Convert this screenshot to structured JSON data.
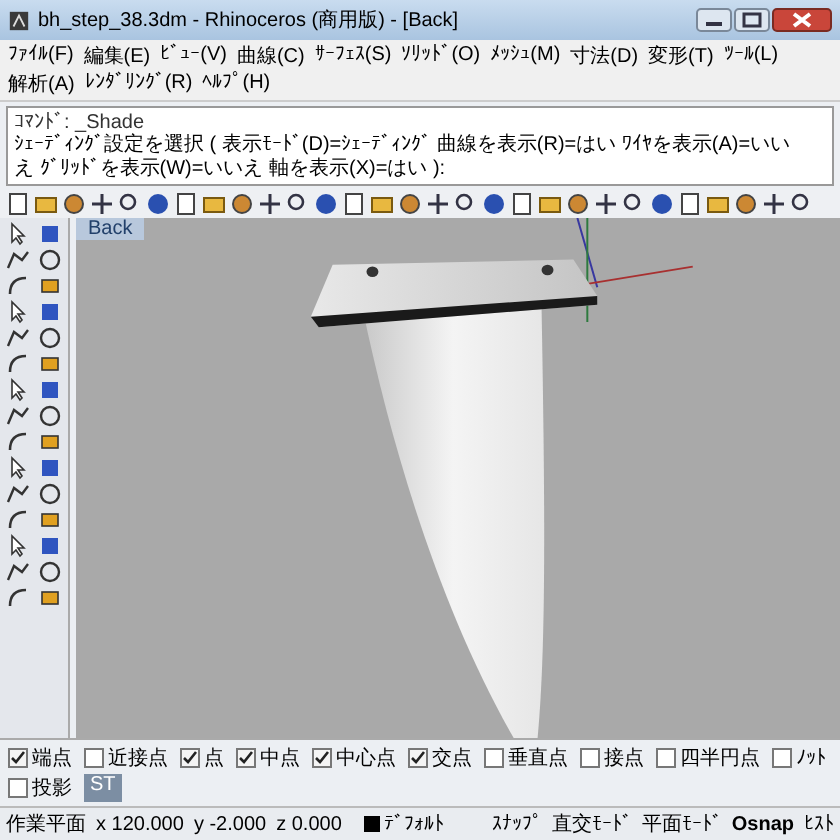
{
  "window": {
    "title": "bh_step_38.3dm - Rhinoceros (商用版) - [Back]"
  },
  "menu": [
    "ﾌｧｲﾙ(F)",
    "編集(E)",
    "ﾋﾞｭｰ(V)",
    "曲線(C)",
    "ｻｰﾌｪｽ(S)",
    "ｿﾘｯﾄﾞ(O)",
    "ﾒｯｼｭ(M)",
    "寸法(D)",
    "変形(T)",
    "ﾂｰﾙ(L)",
    "解析(A)",
    "ﾚﾝﾀﾞﾘﾝｸﾞ(R)",
    "ﾍﾙﾌﾟ(H)"
  ],
  "command": {
    "history": "ｺﾏﾝﾄﾞ: _Shade",
    "prompt": "ｼｪｰﾃﾞｨﾝｸﾞ設定を選択 ( 表示ﾓｰﾄﾞ(D)=ｼｪｰﾃﾞｨﾝｸﾞ 曲線を表示(R)=はい ﾜｲﾔを表示(A)=いいえ ｸﾞﾘｯﾄﾞを表示(W)=いいえ 軸を表示(X)=はい ):"
  },
  "viewport": {
    "label": "Back"
  },
  "osnap": [
    {
      "kind": "checkbox",
      "label": "端点",
      "checked": true
    },
    {
      "kind": "checkbox",
      "label": "近接点",
      "checked": false
    },
    {
      "kind": "checkbox",
      "label": "点",
      "checked": true
    },
    {
      "kind": "checkbox",
      "label": "中点",
      "checked": true
    },
    {
      "kind": "checkbox",
      "label": "中心点",
      "checked": true
    },
    {
      "kind": "checkbox",
      "label": "交点",
      "checked": true
    },
    {
      "kind": "checkbox",
      "label": "垂直点",
      "checked": false
    },
    {
      "kind": "checkbox",
      "label": "接点",
      "checked": false
    },
    {
      "kind": "checkbox",
      "label": "四半円点",
      "checked": false
    },
    {
      "kind": "checkbox",
      "label": "ﾉｯﾄ",
      "checked": false
    },
    {
      "kind": "checkbox",
      "label": "投影",
      "checked": false
    },
    {
      "kind": "button",
      "label": "ST"
    }
  ],
  "status": {
    "cplane": "作業平面",
    "x": "x 120.000",
    "y": "y -2.000",
    "z": "z 0.000",
    "layer": "ﾃﾞﾌｫﾙﾄ",
    "panes": [
      {
        "label": "ｽﾅｯﾌﾟ",
        "on": false
      },
      {
        "label": "直交ﾓｰﾄﾞ",
        "on": false
      },
      {
        "label": "平面ﾓｰﾄﾞ",
        "on": false
      },
      {
        "label": "Osnap",
        "on": true
      },
      {
        "label": "ﾋｽﾄ",
        "on": false
      }
    ]
  }
}
